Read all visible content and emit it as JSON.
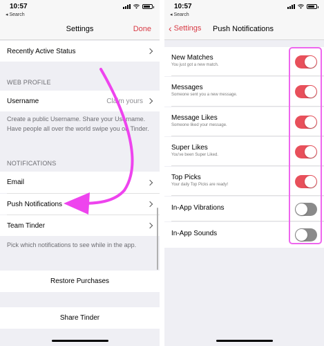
{
  "left": {
    "status": {
      "time": "10:57",
      "back_label": "◂ Search"
    },
    "nav": {
      "title": "Settings",
      "done": "Done"
    },
    "rows": {
      "recently_active": "Recently Active Status",
      "username": "Username",
      "username_value": "Claim yours",
      "email": "Email",
      "push": "Push Notifications",
      "team": "Team Tinder",
      "restore": "Restore Purchases",
      "share": "Share Tinder"
    },
    "sections": {
      "web_profile": "WEB PROFILE",
      "notifications": "NOTIFICATIONS"
    },
    "notes": {
      "username_note": "Create a public Username. Share your Username. Have people all over the world swipe you on Tinder.",
      "notif_note": "Pick which notifications to see while in the app."
    }
  },
  "right": {
    "status": {
      "time": "10:57",
      "back_label": "◂ Search"
    },
    "nav": {
      "back": "Settings",
      "title": "Push Notifications"
    },
    "items": [
      {
        "label": "New Matches",
        "sub": "You just got a new match.",
        "on": true
      },
      {
        "label": "Messages",
        "sub": "Someone sent you a new message.",
        "on": true
      },
      {
        "label": "Message Likes",
        "sub": "Someone liked your message.",
        "on": true
      },
      {
        "label": "Super Likes",
        "sub": "You've been Super Liked.",
        "on": true
      },
      {
        "label": "Top Picks",
        "sub": "Your daily Top Picks are ready!",
        "on": true
      },
      {
        "label": "In-App Vibrations",
        "sub": "",
        "on": false
      },
      {
        "label": "In-App Sounds",
        "sub": "",
        "on": false
      }
    ]
  },
  "colors": {
    "accent": "#d83a44",
    "toggle_on": "#e8505b",
    "highlight": "#ee44ee"
  }
}
